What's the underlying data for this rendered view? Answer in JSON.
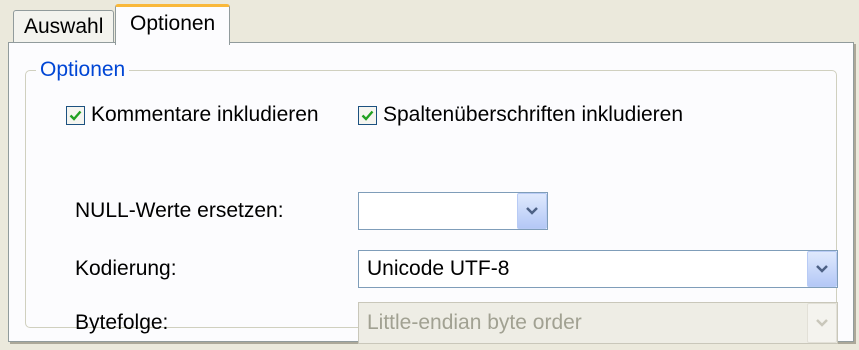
{
  "tabs": [
    {
      "label": "Auswahl",
      "active": false
    },
    {
      "label": "Optionen",
      "active": true
    }
  ],
  "group": {
    "title": "Optionen"
  },
  "checkboxes": {
    "comments": {
      "label": "Kommentare inkludieren",
      "checked": true
    },
    "headers": {
      "label": "Spaltenüberschriften inkludieren",
      "checked": true
    }
  },
  "fields": {
    "null_replace": {
      "label": "NULL-Werte ersetzen:",
      "value": ""
    },
    "encoding": {
      "label": "Kodierung:",
      "value": "Unicode UTF-8"
    },
    "byte_order": {
      "label": "Bytefolge:",
      "value": "Little-endian byte order",
      "disabled": true
    }
  },
  "colors": {
    "accent_tab": "#f9b83a",
    "group_title": "#0046d5",
    "check_mark": "#21a121"
  },
  "icons": {
    "check": "check-icon",
    "dropdown": "chevron-down-icon"
  }
}
